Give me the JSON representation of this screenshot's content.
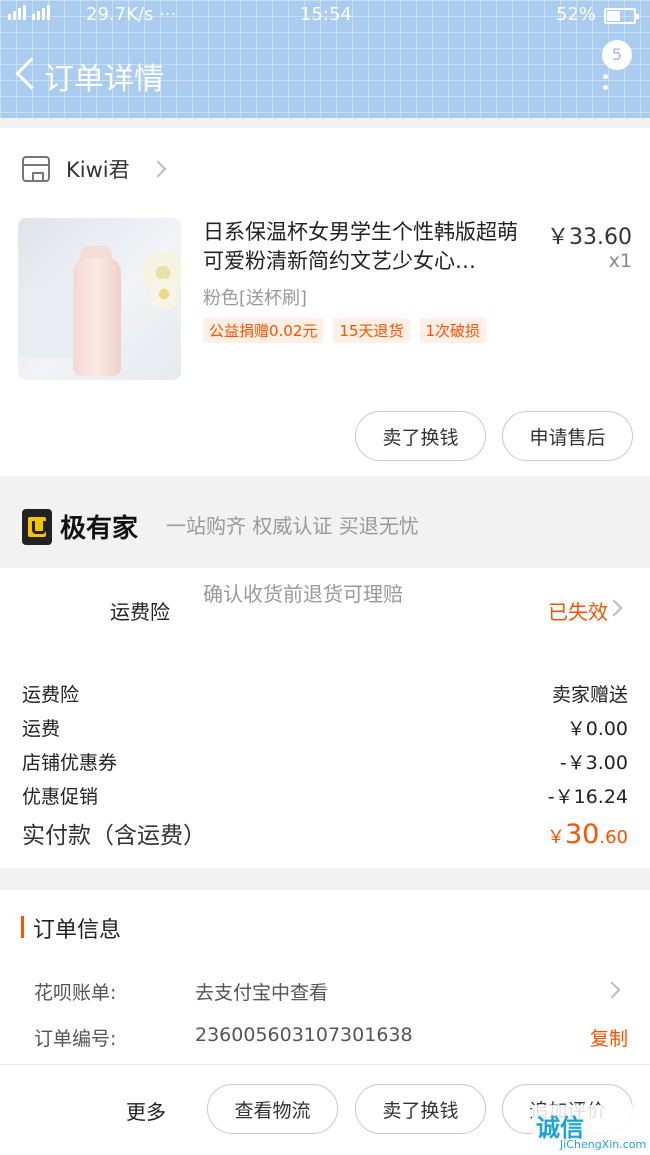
{
  "status_bar": {
    "network_speed": "29.7K/s ···",
    "time": "15:54",
    "battery": "52%",
    "signal_labels": [
      "2G",
      "4G 4G"
    ]
  },
  "header": {
    "title": "订单详情",
    "badge_count": "5"
  },
  "shop": {
    "name": "Kiwi君"
  },
  "product": {
    "title": "日系保温杯女男学生个性韩版超萌可爱粉清新简约文艺少女心…",
    "price": "￥33.60",
    "qty": "x1",
    "sku": "粉色[送杯刷]",
    "tags": [
      "公益捐赠0.02元",
      "15天退货",
      "1次破损"
    ]
  },
  "product_actions": {
    "sell_label": "卖了换钱",
    "after_sale_label": "申请售后"
  },
  "brand": {
    "name": "极有家",
    "slogan": "一站购齐 权威认证 买退无忧"
  },
  "insurance": {
    "label": "运费险",
    "desc": "确认收货前退货可理赔",
    "status": "已失效"
  },
  "fees": [
    {
      "label": "运费险",
      "value": "卖家赠送"
    },
    {
      "label": "运费",
      "value": "￥0.00"
    },
    {
      "label": "店铺优惠券",
      "value": "-￥3.00"
    },
    {
      "label": "优惠促销",
      "value": "-￥16.24"
    }
  ],
  "total": {
    "label": "实付款（含运费）",
    "symbol": "￥",
    "int": "30",
    "dec": ".60"
  },
  "order_info": {
    "title": "订单信息",
    "huabei_label": "花呗账单:",
    "huabei_value": "去支付宝中查看",
    "order_no_label": "订单编号:",
    "order_no_value": "236005603107301638",
    "copy_label": "复制"
  },
  "bottom": {
    "more": "更多",
    "logistics": "查看物流",
    "sell": "卖了换钱",
    "review": "追加评价"
  },
  "watermark": {
    "logo": "诚信",
    "url": "JiChengXin.com"
  }
}
